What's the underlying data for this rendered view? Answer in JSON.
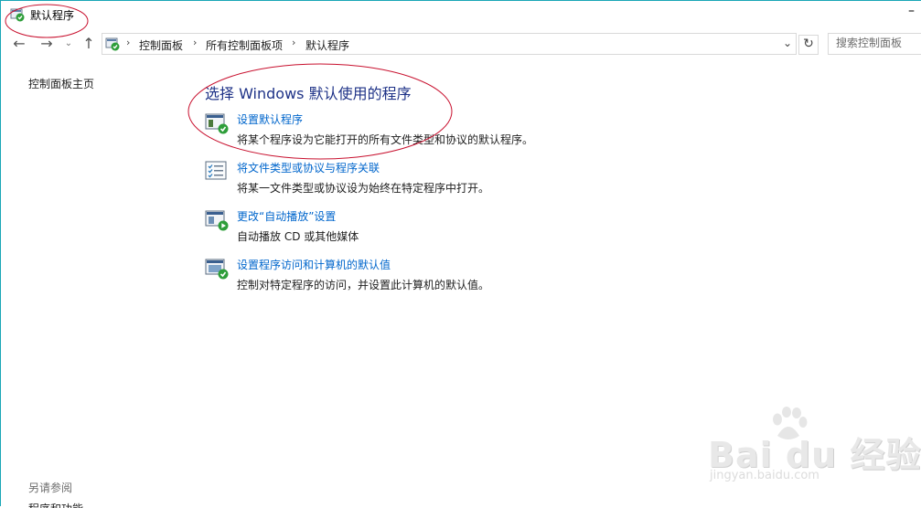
{
  "window": {
    "title": "默认程序",
    "minimize_glyph": "–"
  },
  "nav": {
    "back": "←",
    "forward": "→",
    "recent": "⌄",
    "up": "↑",
    "breadcrumbs": [
      "控制面板",
      "所有控制面板项",
      "默认程序"
    ],
    "separator": "›",
    "dropdown": "⌄",
    "refresh": "↻",
    "search_placeholder": "搜索控制面板"
  },
  "left_pane": {
    "home_link": "控制面板主页",
    "see_also_title": "另请参阅",
    "see_also_item": "程序和功能"
  },
  "main": {
    "heading": "选择 Windows 默认使用的程序",
    "tasks": [
      {
        "icon": "set-default-programs-icon",
        "link": "设置默认程序",
        "desc": "将某个程序设为它能打开的所有文件类型和协议的默认程序。"
      },
      {
        "icon": "file-association-icon",
        "link": "将文件类型或协议与程序关联",
        "desc": "将某一文件类型或协议设为始终在特定程序中打开。"
      },
      {
        "icon": "autoplay-icon",
        "link": "更改“自动播放”设置",
        "desc": "自动播放 CD 或其他媒体"
      },
      {
        "icon": "program-access-icon",
        "link": "设置程序访问和计算机的默认值",
        "desc": "控制对特定程序的访问，并设置此计算机的默认值。"
      }
    ]
  },
  "watermark": {
    "logo_text": "Bai du 经验",
    "url": "jingyan.baidu.com"
  },
  "colors": {
    "heading": "#1e3287",
    "link": "#0066cc",
    "annotation": "#c8102e",
    "frame": "#1aa6b6"
  }
}
